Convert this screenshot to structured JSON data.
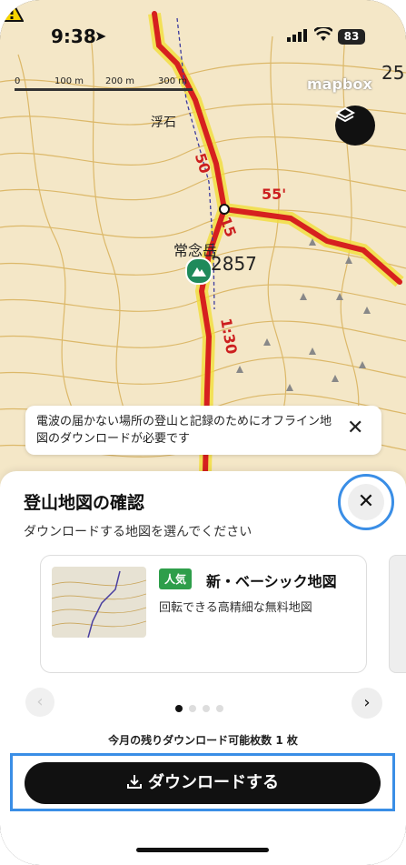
{
  "status_bar": {
    "time": "9:38",
    "battery": "83"
  },
  "map": {
    "scale_labels": [
      "0",
      "100 m",
      "200 m",
      "300 m"
    ],
    "attribution": "mapbox",
    "edge_number": "25",
    "place_names": {
      "ukiishi": "浮石",
      "peak": "常念岳",
      "peak_height": "2857"
    },
    "time_labels": [
      "50",
      "55'",
      "15",
      "1:30"
    ]
  },
  "offline_banner": {
    "text": "電波の届かない場所の登山と記録のためにオフライン地図のダウンロードが必要です"
  },
  "sheet": {
    "title": "登山地図の確認",
    "subtitle": "ダウンロードする地図を選んでください",
    "card": {
      "badge": "人気",
      "title": "新・ベーシック地図",
      "description": "回転できる高精細な無料地図"
    },
    "remaining": "今月の残りダウンロード可能枚数 1 枚",
    "download_label": "ダウンロードする"
  },
  "colors": {
    "route": "#d6201f",
    "highlight": "#3a8ee6",
    "badge": "#2e9e4a",
    "map_bg": "#f4e7c7"
  }
}
